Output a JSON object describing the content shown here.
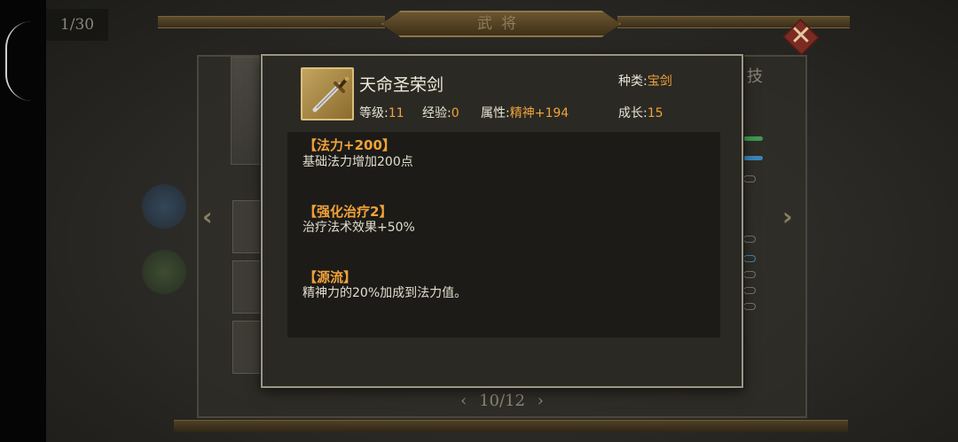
{
  "background": {
    "counter": "1/30",
    "window_title": "武将",
    "close_label": "✕",
    "skill_tab_label": "技",
    "page_indicator": "10/12",
    "prev_arrow": "‹",
    "next_arrow": "›",
    "prev_page_arrow": "‹",
    "next_page_arrow": "›"
  },
  "item": {
    "name": "天命圣荣剑",
    "icon": "sword-icon",
    "type_label": "种类:",
    "type_value": "宝剑",
    "level_label": "等级:",
    "level_value": "11",
    "exp_label": "经验:",
    "exp_value": "0",
    "attr_label": "属性:",
    "attr_value": "精神+194",
    "growth_label": "成长:",
    "growth_value": "15"
  },
  "skills": [
    {
      "title": "【法力+200】",
      "desc": "基础法力增加200点"
    },
    {
      "title": "【强化治疗2】",
      "desc": "治疗法术效果+50%"
    },
    {
      "title": "【源流】",
      "desc": "精神力的20%加成到法力值。"
    }
  ],
  "colors": {
    "accent_gold": "#f0a23a",
    "popup_bg": "#2a2924",
    "popup_border": "#9c9686",
    "desc_bg": "#1c1b18"
  }
}
